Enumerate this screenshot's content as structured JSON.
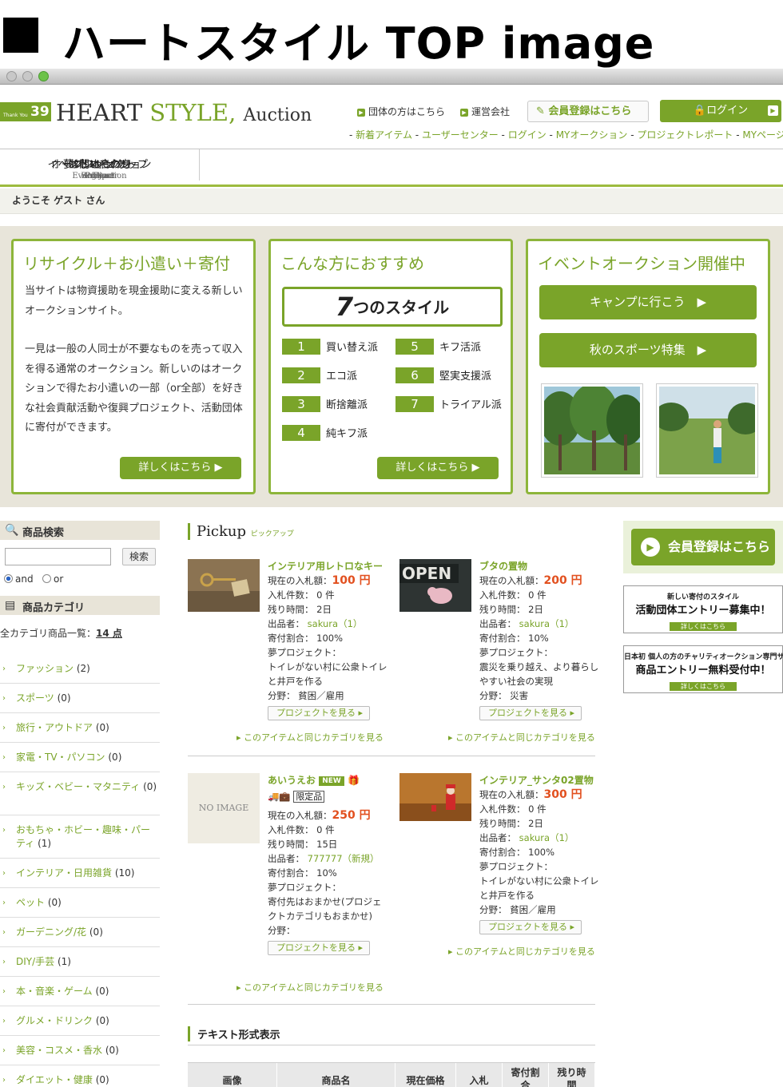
{
  "headline": "ハートスタイル TOP image",
  "logo": {
    "badge_small": "Thank You",
    "badge_num": "39",
    "name_a": "HEART",
    "name_b": "STYLE,",
    "name_c": "Auction"
  },
  "header_links": {
    "groups": "団体の方はこちら",
    "company": "運営会社",
    "register": "会員登録はこちら",
    "login": "ログイン"
  },
  "subnav": [
    "新着アイテム",
    "ユーザーセンター",
    "ログイン",
    "MYオークション",
    "プロジェクトレポート",
    "MYページ"
  ],
  "gnav": [
    {
      "jp": "オークション トップ",
      "en": "Top"
    },
    {
      "jp": "はじめての方",
      "en": "Beginner"
    },
    {
      "jp": "夢プロジェクト",
      "en": "Project"
    },
    {
      "jp": "イベントオークション",
      "en": "EventAuction"
    },
    {
      "jp": "お問い合わせ",
      "en": "Contact"
    }
  ],
  "welcome": "ようこそ ゲスト さん",
  "hero": {
    "panel1": {
      "title": "リサイクル＋お小遣い＋寄付",
      "p1": "当サイトは物資援助を現金援助に変える新しいオークションサイト。",
      "p2": "一見は一般の人同士が不要なものを売って収入を得る通常のオークション。新しいのはオークションで得たお小遣いの一部（or全部）を好きな社会貢献活動や復興プロジェクト、活動団体に寄付ができます。",
      "button": "詳しくはこちら ▶"
    },
    "panel2": {
      "title": "こんな方におすすめ",
      "box_num": "7",
      "box_text": "つのスタイル",
      "styles": [
        {
          "n": "1",
          "label": "買い替え派"
        },
        {
          "n": "2",
          "label": "エコ派"
        },
        {
          "n": "3",
          "label": "断捨離派"
        },
        {
          "n": "4",
          "label": "純キフ派"
        },
        {
          "n": "5",
          "label": "キフ活派"
        },
        {
          "n": "6",
          "label": "堅実支援派"
        },
        {
          "n": "7",
          "label": "トライアル派"
        }
      ],
      "button": "詳しくはこちら ▶"
    },
    "panel3": {
      "title": "イベントオークション開催中",
      "btn1": "キャンプに行こう　▶",
      "btn2": "秋のスポーツ特集　▶"
    }
  },
  "sidebar": {
    "search_title": "商品検索",
    "search_button": "検索",
    "radio_and": "and",
    "radio_or": "or",
    "category_title": "商品カテゴリ",
    "all_label": "全カテゴリ商品一覧：",
    "all_count": "14 点",
    "categories": [
      {
        "name": "ファッション",
        "count": "(2)"
      },
      {
        "name": "スポーツ",
        "count": "(0)"
      },
      {
        "name": "旅行・アウトドア",
        "count": "(0)"
      },
      {
        "name": "家電・TV・パソコン",
        "count": "(0)"
      },
      {
        "name": "キッズ・ベビー・マタニティ",
        "count": "(0)"
      },
      {
        "name": "おもちゃ・ホビー・趣味・パーティ",
        "count": "(1)"
      },
      {
        "name": "インテリア・日用雑貨",
        "count": "(10)"
      },
      {
        "name": "ペット",
        "count": "(0)"
      },
      {
        "name": "ガーデニング/花",
        "count": "(0)"
      },
      {
        "name": "DIY/手芸",
        "count": "(1)"
      },
      {
        "name": "本・音楽・ゲーム",
        "count": "(0)"
      },
      {
        "name": "グルメ・ドリンク",
        "count": "(0)"
      },
      {
        "name": "美容・コスメ・香水",
        "count": "(0)"
      },
      {
        "name": "ダイエット・健康",
        "count": "(0)"
      }
    ]
  },
  "pickup": {
    "title": "Pickup",
    "sub": "ピックアップ",
    "project_button": "プロジェクトを見る ▸",
    "same_category": "このアイテムと同じカテゴリを見る",
    "items": [
      {
        "name": "インテリア用レトロなキー",
        "price_label": "現在の入札額：",
        "price": "100 円",
        "bids": "入札件数： 0 件",
        "remain": "残り時間： 2日",
        "seller_label": "出品者：",
        "seller": "sakura（1）",
        "ratio": "寄付割合： 100%",
        "project_label": "夢プロジェクト：",
        "project": "トイレがない村に公衆トイレと井戸を作る",
        "field": "分野： 貧困／雇用"
      },
      {
        "name": "ブタの置物",
        "price_label": "現在の入札額：",
        "price": "200 円",
        "bids": "入札件数： 0 件",
        "remain": "残り時間： 2日",
        "seller_label": "出品者：",
        "seller": "sakura（1）",
        "ratio": "寄付割合： 10%",
        "project_label": "夢プロジェクト：",
        "project": "震災を乗り越え、より暮らしやすい社会の実現",
        "field": "分野： 災害"
      },
      {
        "name": "あいうえお",
        "new": "NEW",
        "limited": "限定品",
        "noimage": "NO IMAGE",
        "price_label": "現在の入札額：",
        "price": "250 円",
        "bids": "入札件数： 0 件",
        "remain": "残り時間： 15日",
        "seller_label": "出品者：",
        "seller": "777777（新規）",
        "ratio": "寄付割合： 10%",
        "project_label": "夢プロジェクト：",
        "project": "寄付先はおまかせ(プロジェクトカテゴリもおまかせ)",
        "field": "分野："
      },
      {
        "name": "インテリア_サンタ02置物",
        "price_label": "現在の入札額：",
        "price": "300 円",
        "bids": "入札件数： 0 件",
        "remain": "残り時間： 2日",
        "seller_label": "出品者：",
        "seller": "sakura（1）",
        "ratio": "寄付割合： 100%",
        "project_label": "夢プロジェクト：",
        "project": "トイレがない村に公衆トイレと井戸を作る",
        "field": "分野： 貧困／雇用"
      }
    ]
  },
  "text_list": {
    "title": "テキスト形式表示",
    "headers": [
      "画像",
      "商品名",
      "現在価格",
      "入札",
      "寄付割合",
      "残り時間"
    ]
  },
  "right": {
    "register": "会員登録はこちら",
    "banner1": {
      "t1": "新しい寄付のスタイル",
      "t2": "活動団体エントリー募集中！",
      "mini": "詳しくはこちら"
    },
    "banner2": {
      "t1": "日本初 個人の方のチャリティオークション専門サイト",
      "t2": "商品エントリー無料受付中！",
      "mini": "詳しくはこちら"
    }
  }
}
